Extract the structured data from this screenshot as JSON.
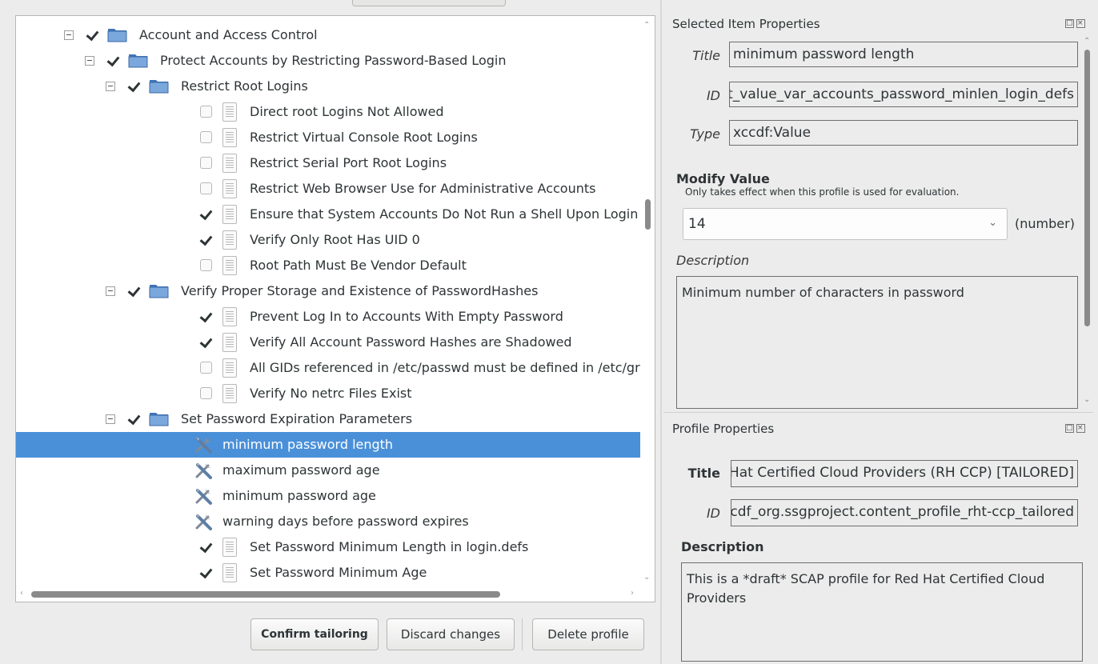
{
  "tree": {
    "rows": [
      {
        "label": "Account and Access Control",
        "kind": "group",
        "checked": true,
        "depth": 0
      },
      {
        "label": "Protect Accounts by Restricting Password-Based Login",
        "kind": "group",
        "checked": true,
        "depth": 1
      },
      {
        "label": "Restrict Root Logins",
        "kind": "group",
        "checked": true,
        "depth": 2
      },
      {
        "label": "Direct root Logins Not Allowed",
        "kind": "rule",
        "checked": false,
        "depth": 3
      },
      {
        "label": "Restrict Virtual Console Root Logins",
        "kind": "rule",
        "checked": false,
        "depth": 3
      },
      {
        "label": "Restrict Serial Port Root Logins",
        "kind": "rule",
        "checked": false,
        "depth": 3
      },
      {
        "label": "Restrict Web Browser Use for Administrative Accounts",
        "kind": "rule",
        "checked": false,
        "depth": 3
      },
      {
        "label": "Ensure that System Accounts Do Not Run a Shell Upon Login",
        "kind": "rule",
        "checked": true,
        "depth": 3
      },
      {
        "label": "Verify Only Root Has UID 0",
        "kind": "rule",
        "checked": true,
        "depth": 3
      },
      {
        "label": "Root Path Must Be Vendor Default",
        "kind": "rule",
        "checked": false,
        "depth": 3
      },
      {
        "label": "Verify Proper Storage and Existence of PasswordHashes",
        "kind": "group",
        "checked": true,
        "depth": 2
      },
      {
        "label": "Prevent Log In to Accounts With Empty Password",
        "kind": "rule",
        "checked": true,
        "depth": 3
      },
      {
        "label": "Verify All Account Password Hashes are Shadowed",
        "kind": "rule",
        "checked": true,
        "depth": 3
      },
      {
        "label": "All GIDs referenced in /etc/passwd must be defined in /etc/grou",
        "kind": "rule",
        "checked": false,
        "depth": 3
      },
      {
        "label": "Verify No netrc Files Exist",
        "kind": "rule",
        "checked": false,
        "depth": 3
      },
      {
        "label": "Set Password Expiration Parameters",
        "kind": "group",
        "checked": true,
        "depth": 2
      },
      {
        "label": "minimum password length",
        "kind": "value",
        "depth": 3,
        "selected": true
      },
      {
        "label": "maximum password age",
        "kind": "value",
        "depth": 3
      },
      {
        "label": "minimum password age",
        "kind": "value",
        "depth": 3
      },
      {
        "label": "warning days before password expires",
        "kind": "value",
        "depth": 3
      },
      {
        "label": "Set Password Minimum Length in login.defs",
        "kind": "rule",
        "checked": true,
        "depth": 3
      },
      {
        "label": "Set Password Minimum Age",
        "kind": "rule",
        "checked": true,
        "depth": 3
      },
      {
        "label": "",
        "kind": "rule",
        "checked": true,
        "depth": 3
      }
    ]
  },
  "buttons": {
    "confirm": "Confirm tailoring",
    "discard": "Discard changes",
    "delete": "Delete profile"
  },
  "selected_item": {
    "panel_title": "Selected Item Properties",
    "title_label": "Title",
    "title_value": "minimum password length",
    "id_label": "ID",
    "id_value": "xccdf_org.ssgproject.content_value_var_accounts_password_minlen_login_defs",
    "type_label": "Type",
    "type_value": "xccdf:Value",
    "modify_heading": "Modify Value",
    "modify_note": "Only takes effect when this profile is used for evaluation.",
    "value": "14",
    "value_unit": "(number)",
    "description_label": "Description",
    "description": "Minimum number of characters in password"
  },
  "profile": {
    "panel_title": "Profile Properties",
    "title_label": "Title",
    "title_value": "Red Hat Certified Cloud Providers (RH CCP) [TAILORED]",
    "id_label": "ID",
    "id_value": "xccdf_org.ssgproject.content_profile_rht-ccp_tailored",
    "description_label": "Description",
    "description": "This is a *draft* SCAP profile for Red Hat Certified Cloud Providers"
  },
  "colors": {
    "selection": "#4a90d9",
    "folder": "#5b8fc9",
    "window_bg": "#ececec"
  }
}
